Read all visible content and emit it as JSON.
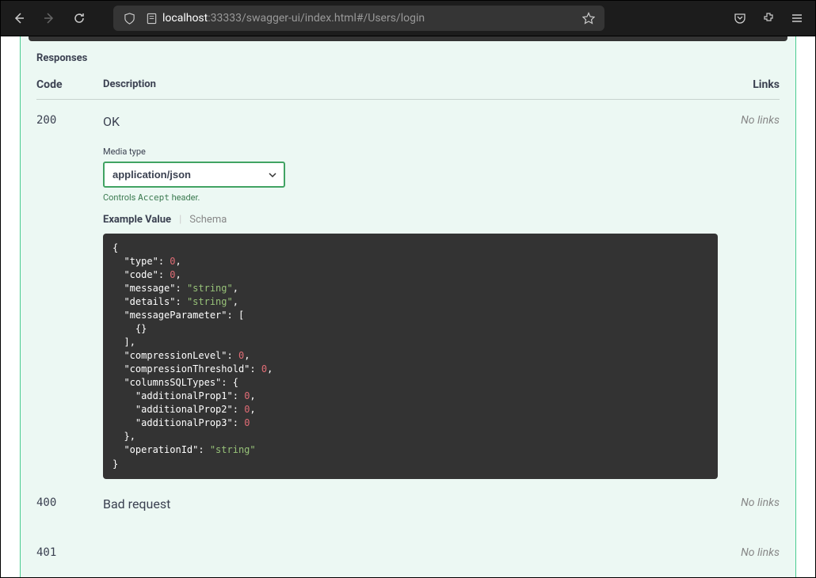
{
  "browser": {
    "url_host": "localhost",
    "url_rest": ":33333/swagger-ui/index.html#/Users/login"
  },
  "responses": {
    "title": "Responses",
    "headers": {
      "code": "Code",
      "description": "Description",
      "links": "Links"
    },
    "rows": [
      {
        "code": "200",
        "description": "OK",
        "links": "No links",
        "media_label": "Media type",
        "media_value": "application/json",
        "accept_note_pre": "Controls ",
        "accept_note_mono": "Accept",
        "accept_note_post": " header.",
        "tab_example": "Example Value",
        "tab_schema": "Schema",
        "example": {
          "type": 0,
          "code": 0,
          "message": "string",
          "details": "string",
          "messageParameter": [
            {}
          ],
          "compressionLevel": 0,
          "compressionThreshold": 0,
          "columnsSQLTypes": {
            "additionalProp1": 0,
            "additionalProp2": 0,
            "additionalProp3": 0
          },
          "operationId": "string"
        }
      },
      {
        "code": "400",
        "description": "Bad request",
        "links": "No links"
      },
      {
        "code": "401",
        "description": "",
        "links": "No links"
      }
    ]
  }
}
